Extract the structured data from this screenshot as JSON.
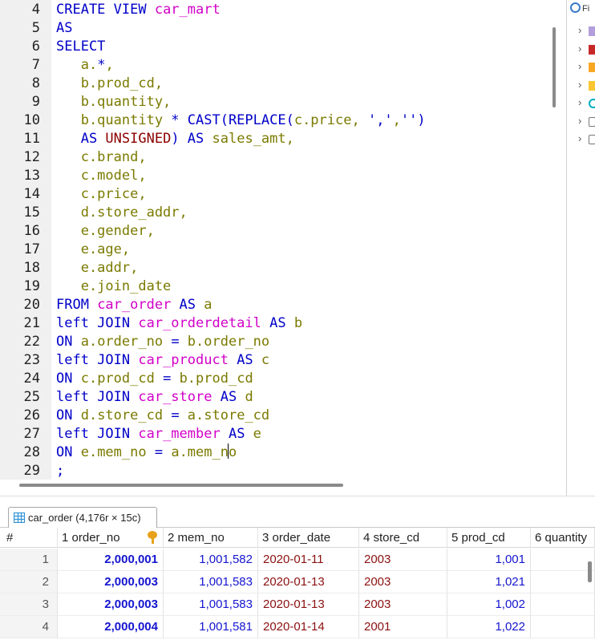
{
  "editor": {
    "lines": [
      {
        "n": "4",
        "tokens": [
          [
            "kw",
            "CREATE VIEW "
          ],
          [
            "tbl",
            "car_mart"
          ]
        ]
      },
      {
        "n": "5",
        "tokens": [
          [
            "kw",
            "AS"
          ]
        ]
      },
      {
        "n": "6",
        "tokens": [
          [
            "kw",
            "SELECT"
          ]
        ]
      },
      {
        "n": "7",
        "tokens": [
          [
            "col",
            "   a."
          ],
          [
            "kw",
            "*"
          ],
          [
            "col",
            ","
          ]
        ]
      },
      {
        "n": "8",
        "tokens": [
          [
            "col",
            "   b.prod_cd,"
          ]
        ]
      },
      {
        "n": "9",
        "tokens": [
          [
            "col",
            "   b.quantity,"
          ]
        ]
      },
      {
        "n": "10",
        "tokens": [
          [
            "col",
            "   b.quantity "
          ],
          [
            "kw",
            "* CAST(REPLACE("
          ],
          [
            "col",
            "c.price, "
          ],
          [
            "str",
            "','"
          ],
          [
            "col",
            ","
          ],
          [
            "str",
            "''"
          ],
          [
            "kw",
            ")"
          ]
        ]
      },
      {
        "n": "11",
        "tokens": [
          [
            "kw",
            "   AS "
          ],
          [
            "red",
            "UNSIGNED"
          ],
          [
            "kw",
            ") AS "
          ],
          [
            "col",
            "sales_amt,"
          ]
        ]
      },
      {
        "n": "12",
        "tokens": [
          [
            "col",
            "   c.brand,"
          ]
        ]
      },
      {
        "n": "13",
        "tokens": [
          [
            "col",
            "   c.model,"
          ]
        ]
      },
      {
        "n": "14",
        "tokens": [
          [
            "col",
            "   c.price,"
          ]
        ]
      },
      {
        "n": "15",
        "tokens": [
          [
            "col",
            "   d.store_addr,"
          ]
        ]
      },
      {
        "n": "16",
        "tokens": [
          [
            "col",
            "   e.gender,"
          ]
        ]
      },
      {
        "n": "17",
        "tokens": [
          [
            "col",
            "   e.age,"
          ]
        ]
      },
      {
        "n": "18",
        "tokens": [
          [
            "col",
            "   e.addr,"
          ]
        ]
      },
      {
        "n": "19",
        "tokens": [
          [
            "col",
            "   e.join_date"
          ]
        ]
      },
      {
        "n": "20",
        "tokens": [
          [
            "kw",
            "FROM "
          ],
          [
            "tbl",
            "car_order"
          ],
          [
            "kw",
            " AS "
          ],
          [
            "col",
            "a"
          ]
        ]
      },
      {
        "n": "21",
        "tokens": [
          [
            "kw",
            "left JOIN "
          ],
          [
            "tbl",
            "car_orderdetail"
          ],
          [
            "kw",
            " AS "
          ],
          [
            "col",
            "b"
          ]
        ]
      },
      {
        "n": "22",
        "tokens": [
          [
            "kw",
            "ON "
          ],
          [
            "col",
            "a.order_no "
          ],
          [
            "kw",
            "= "
          ],
          [
            "col",
            "b.order_no"
          ]
        ]
      },
      {
        "n": "23",
        "tokens": [
          [
            "kw",
            "left JOIN "
          ],
          [
            "tbl",
            "car_product"
          ],
          [
            "kw",
            " AS "
          ],
          [
            "col",
            "c"
          ]
        ]
      },
      {
        "n": "24",
        "tokens": [
          [
            "kw",
            "ON "
          ],
          [
            "col",
            "c.prod_cd "
          ],
          [
            "kw",
            "= "
          ],
          [
            "col",
            "b.prod_cd"
          ]
        ]
      },
      {
        "n": "25",
        "tokens": [
          [
            "kw",
            "left JOIN "
          ],
          [
            "tbl",
            "car_store"
          ],
          [
            "kw",
            " AS "
          ],
          [
            "col",
            "d"
          ]
        ]
      },
      {
        "n": "26",
        "tokens": [
          [
            "kw",
            "ON "
          ],
          [
            "col",
            "d.store_cd "
          ],
          [
            "kw",
            "= "
          ],
          [
            "col",
            "a.store_cd"
          ]
        ]
      },
      {
        "n": "27",
        "tokens": [
          [
            "kw",
            "left JOIN "
          ],
          [
            "tbl",
            "car_member"
          ],
          [
            "kw",
            " AS "
          ],
          [
            "col",
            "e"
          ]
        ]
      },
      {
        "n": "28",
        "tokens": [
          [
            "kw",
            "ON "
          ],
          [
            "col",
            "e.mem_no "
          ],
          [
            "kw",
            "= "
          ],
          [
            "col",
            "a.mem_n"
          ],
          [
            "caret",
            ""
          ],
          [
            "col",
            "o"
          ]
        ]
      },
      {
        "n": "29",
        "tokens": [
          [
            "kw",
            ";"
          ]
        ]
      }
    ]
  },
  "sidebar": {
    "filter_label": "Fi",
    "items": [
      {
        "icon": "table-group-icon",
        "color": "#b39ddb"
      },
      {
        "icon": "function-icon",
        "color": "#c62828"
      },
      {
        "icon": "procedure-icon",
        "color": "#f9a825"
      },
      {
        "icon": "folder-icon",
        "color": "#f9c531"
      },
      {
        "icon": "schema-icon",
        "color": "#00acc1"
      },
      {
        "icon": "view-icon",
        "color": "#777777"
      },
      {
        "icon": "trigger-icon",
        "color": "#777777"
      }
    ]
  },
  "results": {
    "tab_label": "car_order (4,176r × 15c)",
    "columns": [
      {
        "label": "#"
      },
      {
        "label": "1 order_no",
        "key": true
      },
      {
        "label": "2 mem_no"
      },
      {
        "label": "3 order_date"
      },
      {
        "label": "4 store_cd"
      },
      {
        "label": "5 prod_cd"
      },
      {
        "label": "6 quantity"
      }
    ],
    "rows": [
      {
        "rn": "1",
        "order_no": "2,000,001",
        "mem_no": "1,001,582",
        "order_date": "2020-01-11",
        "store_cd": "2003",
        "prod_cd": "1,001",
        "quantity": ""
      },
      {
        "rn": "2",
        "order_no": "2,000,003",
        "mem_no": "1,001,583",
        "order_date": "2020-01-13",
        "store_cd": "2003",
        "prod_cd": "1,021",
        "quantity": ""
      },
      {
        "rn": "3",
        "order_no": "2,000,003",
        "mem_no": "1,001,583",
        "order_date": "2020-01-13",
        "store_cd": "2003",
        "prod_cd": "1,002",
        "quantity": ""
      },
      {
        "rn": "4",
        "order_no": "2,000,004",
        "mem_no": "1,001,581",
        "order_date": "2020-01-14",
        "store_cd": "2001",
        "prod_cd": "1,022",
        "quantity": ""
      }
    ]
  }
}
